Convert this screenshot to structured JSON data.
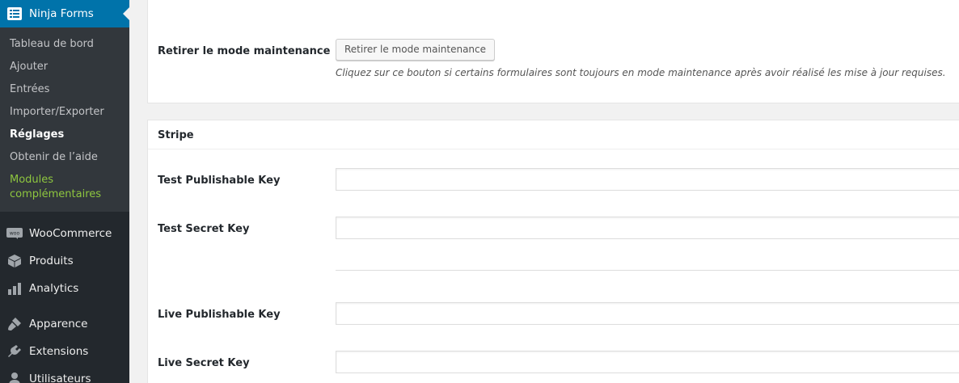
{
  "sidebar": {
    "current_menu": "Ninja Forms",
    "submenu": [
      "Tableau de bord",
      "Ajouter",
      "Entrées",
      "Importer/Exporter",
      "Réglages",
      "Obtenir de l’aide",
      "Modules complémentaires"
    ],
    "items": [
      "WooCommerce",
      "Produits",
      "Analytics",
      "Apparence",
      "Extensions",
      "Utilisateurs"
    ]
  },
  "maintenance": {
    "label": "Retirer le mode maintenance",
    "button_label": "Retirer le mode maintenance",
    "description": "Cliquez sur ce bouton si certains formulaires sont toujours en mode maintenance après avoir réalisé les mise à jour requises."
  },
  "stripe": {
    "title": "Stripe",
    "fields": [
      {
        "label": "Test Publishable Key",
        "value": ""
      },
      {
        "label": "Test Secret Key",
        "value": ""
      },
      {
        "label": "Live Publishable Key",
        "value": ""
      },
      {
        "label": "Live Secret Key",
        "value": ""
      }
    ]
  },
  "colors": {
    "sidebar_bg": "#23282d",
    "submenu_bg": "#32373c",
    "active_menu": "#0073aa",
    "addon_green": "#8ec63f"
  }
}
